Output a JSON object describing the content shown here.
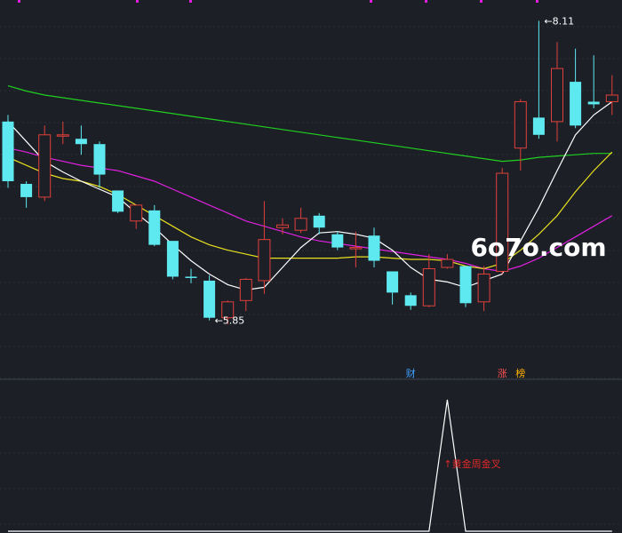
{
  "colors": {
    "background": "#1c1f26",
    "grid": "#2a2f3a",
    "up": "#e0403a",
    "down": "#5ee8f0",
    "ma5": "#ffffff",
    "ma10": "#e8e020",
    "ma20": "#e020e0",
    "ma60": "#20d020",
    "signal": "#ffffff",
    "signal_text": "#e02828",
    "badge_cai": "#40a0ff",
    "badge_zhang": "#ff5050",
    "badge_bang": "#ffb000"
  },
  "watermark": "6o7o.com",
  "badges": [
    {
      "text": "财",
      "index": 22,
      "color_key": "badge_cai"
    },
    {
      "text": "涨",
      "index": 27,
      "color_key": "badge_zhang"
    },
    {
      "text": "榜",
      "index": 28,
      "color_key": "badge_bang"
    }
  ],
  "chart_data": {
    "type": "candlestick",
    "ylim": [
      5.6,
      8.2
    ],
    "candles": [
      {
        "o": 7.35,
        "h": 7.4,
        "c": 6.9,
        "l": 6.85
      },
      {
        "o": 6.88,
        "h": 6.9,
        "c": 6.78,
        "l": 6.7
      },
      {
        "o": 6.78,
        "h": 7.32,
        "c": 7.25,
        "l": 6.75
      },
      {
        "o": 7.25,
        "h": 7.35,
        "c": 7.25,
        "l": 7.18
      },
      {
        "o": 7.22,
        "h": 7.32,
        "c": 7.18,
        "l": 7.1
      },
      {
        "o": 7.18,
        "h": 7.2,
        "c": 6.95,
        "l": 6.85
      },
      {
        "o": 6.83,
        "h": 6.83,
        "c": 6.67,
        "l": 6.66
      },
      {
        "o": 6.6,
        "h": 6.72,
        "c": 6.72,
        "l": 6.54
      },
      {
        "o": 6.68,
        "h": 6.72,
        "c": 6.42,
        "l": 6.41
      },
      {
        "o": 6.45,
        "h": 6.45,
        "c": 6.18,
        "l": 6.16
      },
      {
        "o": 6.18,
        "h": 6.24,
        "c": 6.17,
        "l": 6.13
      },
      {
        "o": 6.15,
        "h": 6.19,
        "c": 5.87,
        "l": 5.85
      },
      {
        "o": 5.87,
        "h": 6.0,
        "c": 5.99,
        "l": 5.82
      },
      {
        "o": 6.0,
        "h": 6.17,
        "c": 6.16,
        "l": 5.92
      },
      {
        "o": 6.15,
        "h": 6.75,
        "c": 6.46,
        "l": 6.05
      },
      {
        "o": 6.55,
        "h": 6.62,
        "c": 6.57,
        "l": 6.5
      },
      {
        "o": 6.53,
        "h": 6.7,
        "c": 6.62,
        "l": 6.51
      },
      {
        "o": 6.64,
        "h": 6.66,
        "c": 6.55,
        "l": 6.5
      },
      {
        "o": 6.5,
        "h": 6.52,
        "c": 6.4,
        "l": 6.38
      },
      {
        "o": 6.4,
        "h": 6.52,
        "c": 6.4,
        "l": 6.25
      },
      {
        "o": 6.49,
        "h": 6.55,
        "c": 6.3,
        "l": 6.25
      },
      {
        "o": 6.22,
        "h": 6.22,
        "c": 6.06,
        "l": 5.97
      },
      {
        "o": 6.04,
        "h": 6.06,
        "c": 5.96,
        "l": 5.93
      },
      {
        "o": 5.96,
        "h": 6.35,
        "c": 6.24,
        "l": 5.95
      },
      {
        "o": 6.25,
        "h": 6.35,
        "c": 6.31,
        "l": 6.24
      },
      {
        "o": 6.26,
        "h": 6.26,
        "c": 5.98,
        "l": 5.95
      },
      {
        "o": 5.99,
        "h": 6.26,
        "c": 6.2,
        "l": 5.92
      },
      {
        "o": 6.22,
        "h": 7.0,
        "c": 6.96,
        "l": 6.2
      },
      {
        "o": 7.15,
        "h": 7.52,
        "c": 7.5,
        "l": 6.98
      },
      {
        "o": 7.38,
        "h": 8.11,
        "c": 7.25,
        "l": 7.22
      },
      {
        "o": 7.35,
        "h": 7.95,
        "c": 7.75,
        "l": 7.2
      },
      {
        "o": 7.65,
        "h": 7.9,
        "c": 7.32,
        "l": 7.3
      },
      {
        "o": 7.5,
        "h": 7.85,
        "c": 7.48,
        "l": 7.45
      },
      {
        "o": 7.5,
        "h": 7.7,
        "c": 7.55,
        "l": 7.4
      }
    ],
    "ma": [
      {
        "key": "ma5",
        "values": [
          7.35,
          7.2,
          7.05,
          6.97,
          6.9,
          6.84,
          6.78,
          6.66,
          6.55,
          6.42,
          6.3,
          6.2,
          6.12,
          6.08,
          6.1,
          6.25,
          6.4,
          6.51,
          6.52,
          6.5,
          6.47,
          6.38,
          6.25,
          6.16,
          6.14,
          6.1,
          6.15,
          6.2,
          6.45,
          6.7,
          6.98,
          7.25,
          7.4,
          7.5
        ]
      },
      {
        "key": "ma10",
        "values": [
          7.08,
          7.02,
          6.96,
          6.92,
          6.9,
          6.86,
          6.8,
          6.72,
          6.64,
          6.56,
          6.48,
          6.42,
          6.38,
          6.35,
          6.32,
          6.32,
          6.32,
          6.32,
          6.32,
          6.33,
          6.33,
          6.32,
          6.31,
          6.31,
          6.3,
          6.26,
          6.24,
          6.28,
          6.38,
          6.5,
          6.64,
          6.82,
          6.98,
          7.12
        ]
      },
      {
        "key": "ma20",
        "values": [
          7.15,
          7.12,
          7.08,
          7.05,
          7.02,
          7.0,
          6.98,
          6.94,
          6.9,
          6.84,
          6.78,
          6.72,
          6.66,
          6.6,
          6.56,
          6.52,
          6.48,
          6.45,
          6.43,
          6.41,
          6.39,
          6.37,
          6.35,
          6.33,
          6.31,
          6.28,
          6.24,
          6.22,
          6.26,
          6.32,
          6.4,
          6.48,
          6.56,
          6.64
        ]
      },
      {
        "key": "ma60",
        "values": [
          7.62,
          7.58,
          7.55,
          7.53,
          7.51,
          7.49,
          7.47,
          7.45,
          7.43,
          7.41,
          7.39,
          7.37,
          7.35,
          7.33,
          7.31,
          7.29,
          7.27,
          7.25,
          7.23,
          7.21,
          7.19,
          7.17,
          7.15,
          7.13,
          7.11,
          7.09,
          7.07,
          7.05,
          7.06,
          7.08,
          7.09,
          7.1,
          7.11,
          7.11
        ]
      }
    ],
    "annotations": [
      {
        "text": "8.11",
        "index": 29,
        "value": 8.11,
        "arrow": "←"
      },
      {
        "text": "5.85",
        "index": 11,
        "value": 5.85,
        "arrow": "←"
      }
    ],
    "signal": {
      "label": "↑黄金周金叉",
      "values": [
        0,
        0,
        0,
        0,
        0,
        0,
        0,
        0,
        0,
        0,
        0,
        0,
        0,
        0,
        0,
        0,
        0,
        0,
        0,
        0,
        0,
        0,
        0,
        0,
        1,
        0,
        0,
        0,
        0,
        0,
        0,
        0,
        0,
        0
      ]
    }
  }
}
